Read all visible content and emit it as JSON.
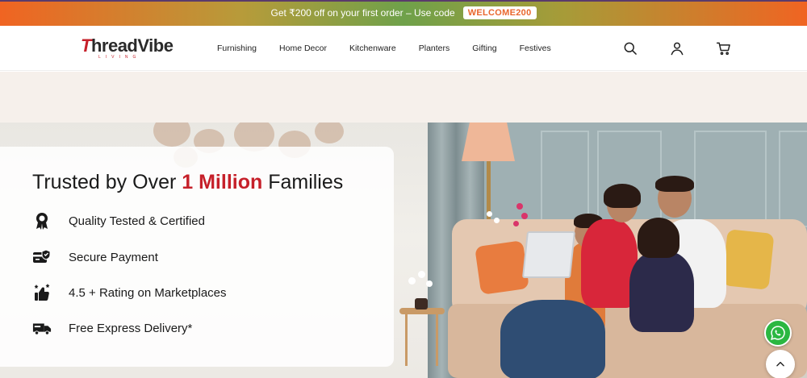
{
  "promo": {
    "text": "Get ₹200 off on your first order – Use code",
    "code": "WELCOME200"
  },
  "brand": {
    "name_initial": "T",
    "name_rest": "hreadVibe",
    "tagline": "LIVING",
    "accent_color": "#c6202a"
  },
  "nav": {
    "items": [
      "Furnishing",
      "Home Decor",
      "Kitchenware",
      "Planters",
      "Gifting",
      "Festives"
    ],
    "icons": [
      "search-icon",
      "user-icon",
      "cart-icon"
    ]
  },
  "trust": {
    "title_prefix": "Trusted by Over ",
    "title_highlight": "1 Million",
    "title_suffix": " Families",
    "items": [
      {
        "icon": "award-badge-icon",
        "label": "Quality Tested & Certified"
      },
      {
        "icon": "secure-card-icon",
        "label": "Secure Payment"
      },
      {
        "icon": "thumbs-up-stars-icon",
        "label": "4.5 + Rating on Marketplaces"
      },
      {
        "icon": "delivery-truck-icon",
        "label": "Free Express Delivery*"
      }
    ]
  },
  "floating": {
    "whatsapp_icon": "whatsapp-icon",
    "scroll_top_icon": "chevron-up-icon"
  }
}
